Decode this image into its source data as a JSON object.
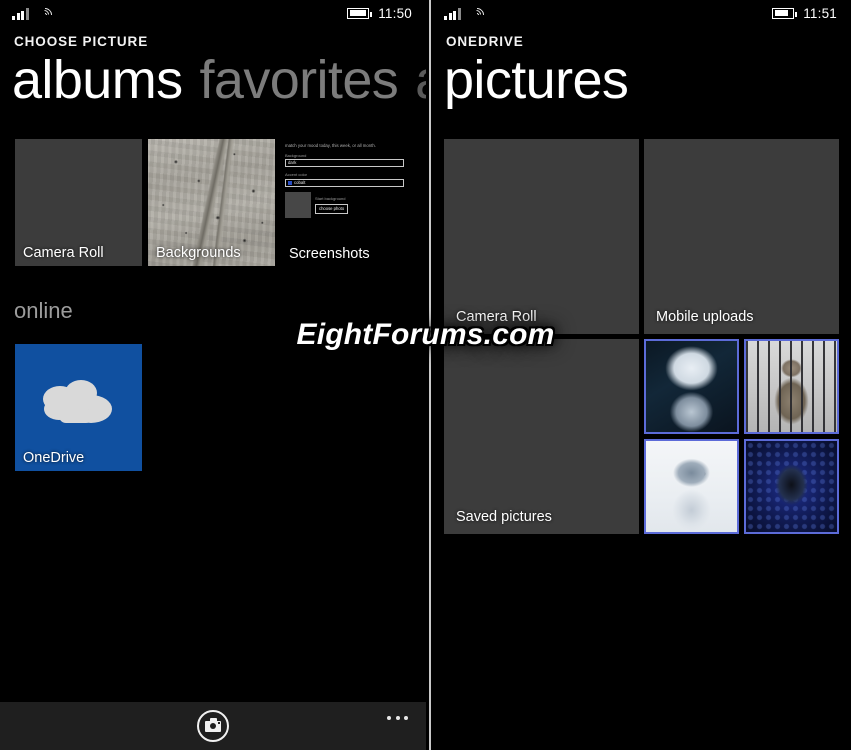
{
  "left_panel": {
    "status": {
      "signal_icon": "signal-bars-icon",
      "wifi_icon": "wifi-icon",
      "battery_icon": "battery-icon",
      "time": "11:50"
    },
    "app_title": "CHOOSE PICTURE",
    "pivots": [
      {
        "label": "albums",
        "state": "active"
      },
      {
        "label": "favorites",
        "state": "inactive"
      },
      {
        "label": "all",
        "state": "faded"
      }
    ],
    "tiles": [
      {
        "label": "Camera Roll",
        "kind": "grey"
      },
      {
        "label": "Backgrounds",
        "kind": "concrete"
      },
      {
        "label": "Screenshots",
        "kind": "settings-preview"
      }
    ],
    "screenshot_preview": {
      "subtitle": "match your mood today, this week, or all month.",
      "background_label": "Background",
      "background_value": "dark",
      "accent_label": "Accent color",
      "accent_value": "cobalt",
      "accent_color": "#2a4ec4",
      "start_background_label": "Start background",
      "choose_photo_button": "choose photo"
    },
    "section_online": "online",
    "online_tile": {
      "label": "OneDrive",
      "icon": "cloud-icon",
      "color": "#1050a0"
    },
    "appbar": {
      "camera_icon": "camera-icon",
      "more_icon": "ellipsis-icon"
    }
  },
  "right_panel": {
    "status": {
      "signal_icon": "signal-bars-icon",
      "wifi_icon": "wifi-icon",
      "battery_icon": "battery-icon",
      "time": "11:51"
    },
    "app_title": "ONEDRIVE",
    "page_title": "pictures",
    "folders": [
      {
        "label": "Camera Roll"
      },
      {
        "label": "Mobile uploads"
      },
      {
        "label": "Saved pictures"
      }
    ],
    "photos": [
      {
        "name": "alien-portrait-blue",
        "border_color": "#5c6bd8"
      },
      {
        "name": "alien-behind-bars",
        "border_color": "#5c6bd8"
      },
      {
        "name": "alien-white-xray",
        "border_color": "#5c6bd8"
      },
      {
        "name": "alienware-head-blue",
        "border_color": "#5c6bd8"
      }
    ]
  },
  "watermark": "EightForums.com"
}
